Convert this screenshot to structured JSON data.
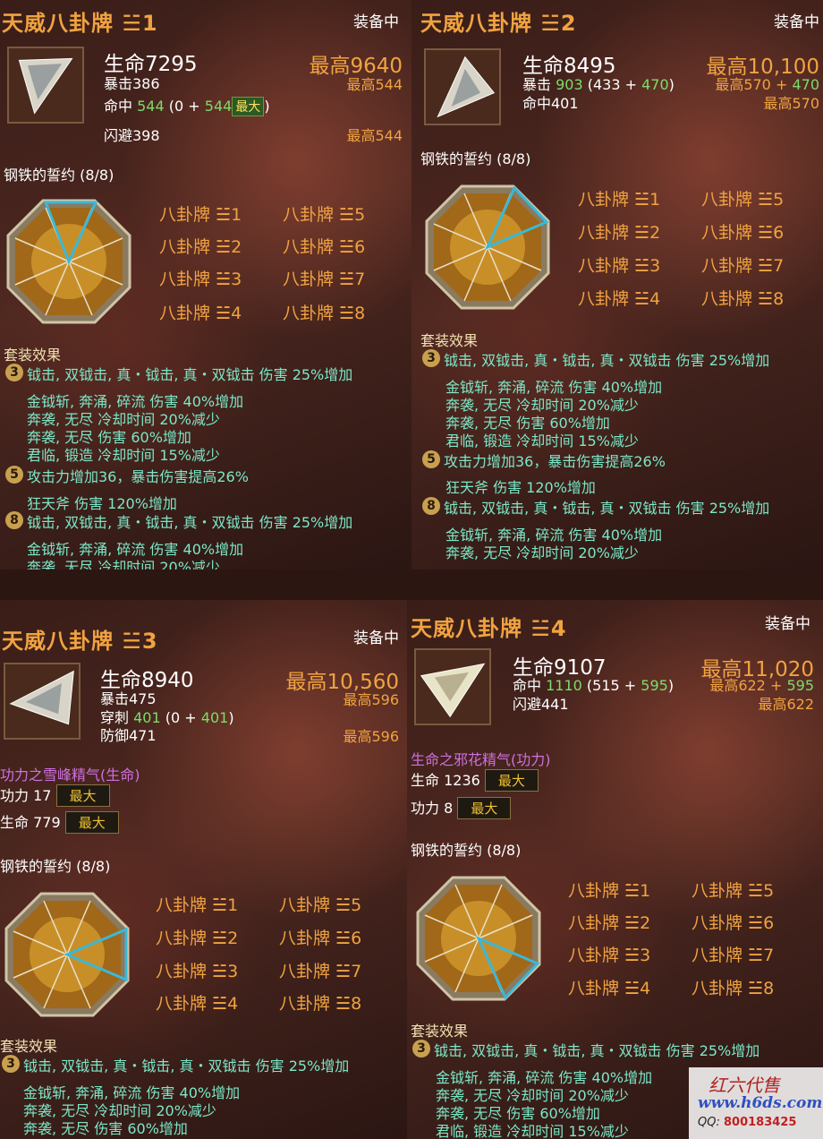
{
  "panels": [
    {
      "title": "天威八卦牌 ☱1",
      "equipped": "装备中",
      "stats": {
        "hp": "生命7295",
        "line2": "暴击386",
        "line3_a": "命中",
        "line3_b": "544",
        "line3_c": "(0 +",
        "line3_d": "544",
        "line3_badge": "最大",
        "line3_e": ")",
        "line4": "闪避398"
      },
      "max": {
        "hp": "最高9640",
        "line2": "最高544",
        "line4": "最高544"
      },
      "set_name": "钢铁的誓约 (8/8)",
      "set_effect_title": "套装效果"
    },
    {
      "title": "天威八卦牌 ☱2",
      "equipped": "装备中",
      "stats": {
        "hp": "生命8495",
        "line2_a": "暴击",
        "line2_b": "903",
        "line2_c": "(433 +",
        "line2_d": "470",
        "line2_e": ")",
        "line3": "命中401"
      },
      "max": {
        "hp": "最高10,100",
        "line2_a": "最高570 +",
        "line2_b": "470",
        "line3": "最高570"
      },
      "set_name": "钢铁的誓约 (8/8)",
      "set_effect_title": "套装效果"
    },
    {
      "title": "天威八卦牌 ☱3",
      "equipped": "装备中",
      "stats": {
        "hp": "生命8940",
        "line2": "暴击475",
        "line3_a": "穿刺",
        "line3_b": "401",
        "line3_c": "(0 +",
        "line3_d": "401",
        "line3_e": ")",
        "line4": "防御471"
      },
      "max": {
        "hp": "最高10,560",
        "line2": "最高596",
        "line4": "最高596"
      },
      "spirit": "功力之雪峰精气(生命)",
      "spirit_line1": "功力 17",
      "spirit_line2": "生命 779",
      "max_label": "最大",
      "set_name": "钢铁的誓约 (8/8)",
      "set_effect_title": "套装效果"
    },
    {
      "title": "天威八卦牌 ☱4",
      "equipped": "装备中",
      "stats": {
        "hp": "生命9107",
        "line2_a": "命中",
        "line2_b": "1110",
        "line2_c": "(515 +",
        "line2_d": "595",
        "line2_e": ")",
        "line3": "闪避441"
      },
      "max": {
        "hp": "最高11,020",
        "line2_a": "最高622 +",
        "line2_b": "595",
        "line3": "最高622"
      },
      "spirit": "生命之邪花精气(功力)",
      "spirit_line1": "生命 1236",
      "spirit_line2": "功力 8",
      "max_label": "最大",
      "set_name": "钢铁的誓约 (8/8)",
      "set_effect_title": "套装效果"
    }
  ],
  "pieces": [
    "八卦牌 ☱1",
    "八卦牌 ☱2",
    "八卦牌 ☱3",
    "八卦牌 ☱4",
    "八卦牌 ☱5",
    "八卦牌 ☱6",
    "八卦牌 ☱7",
    "八卦牌 ☱8"
  ],
  "set_effects": {
    "tier3": "3",
    "tier3_main": "钺击, 双钺击, 真・钺击, 真・双钺击 伤害 25%增加",
    "tier3_sub": [
      "金钺斩, 奔涌, 碎流 伤害 40%增加",
      "奔袭, 无尽 冷却时间 20%减少",
      "奔袭, 无尽 伤害 60%增加",
      "君临, 锻造 冷却时间 15%减少"
    ],
    "tier5": "5",
    "tier5_main": "攻击力增加36，暴击伤害提高26%",
    "tier5_sub": [
      "狂天斧 伤害 120%增加"
    ],
    "tier8": "8",
    "tier8_main": "钺击, 双钺击, 真・钺击, 真・双钺击 伤害 25%增加",
    "tier8_sub": [
      "金钺斩, 奔涌, 碎流 伤害 40%增加",
      "奔袭, 无尽 冷却时间 20%减少",
      "奔袭, 无尽 伤害 60%增加",
      "君临, 锻造 冷却时间 15%减少"
    ]
  },
  "watermark": {
    "name": "红六代售",
    "url": "www.h6ds.com",
    "qq_label": "QQ:",
    "qq_number": "800183425"
  },
  "colors": {
    "orange": "#f0a340",
    "green": "#7ddc6a",
    "teal": "#7ce8c8",
    "purple": "#d070e0",
    "highlight": "#3ab8d8"
  }
}
